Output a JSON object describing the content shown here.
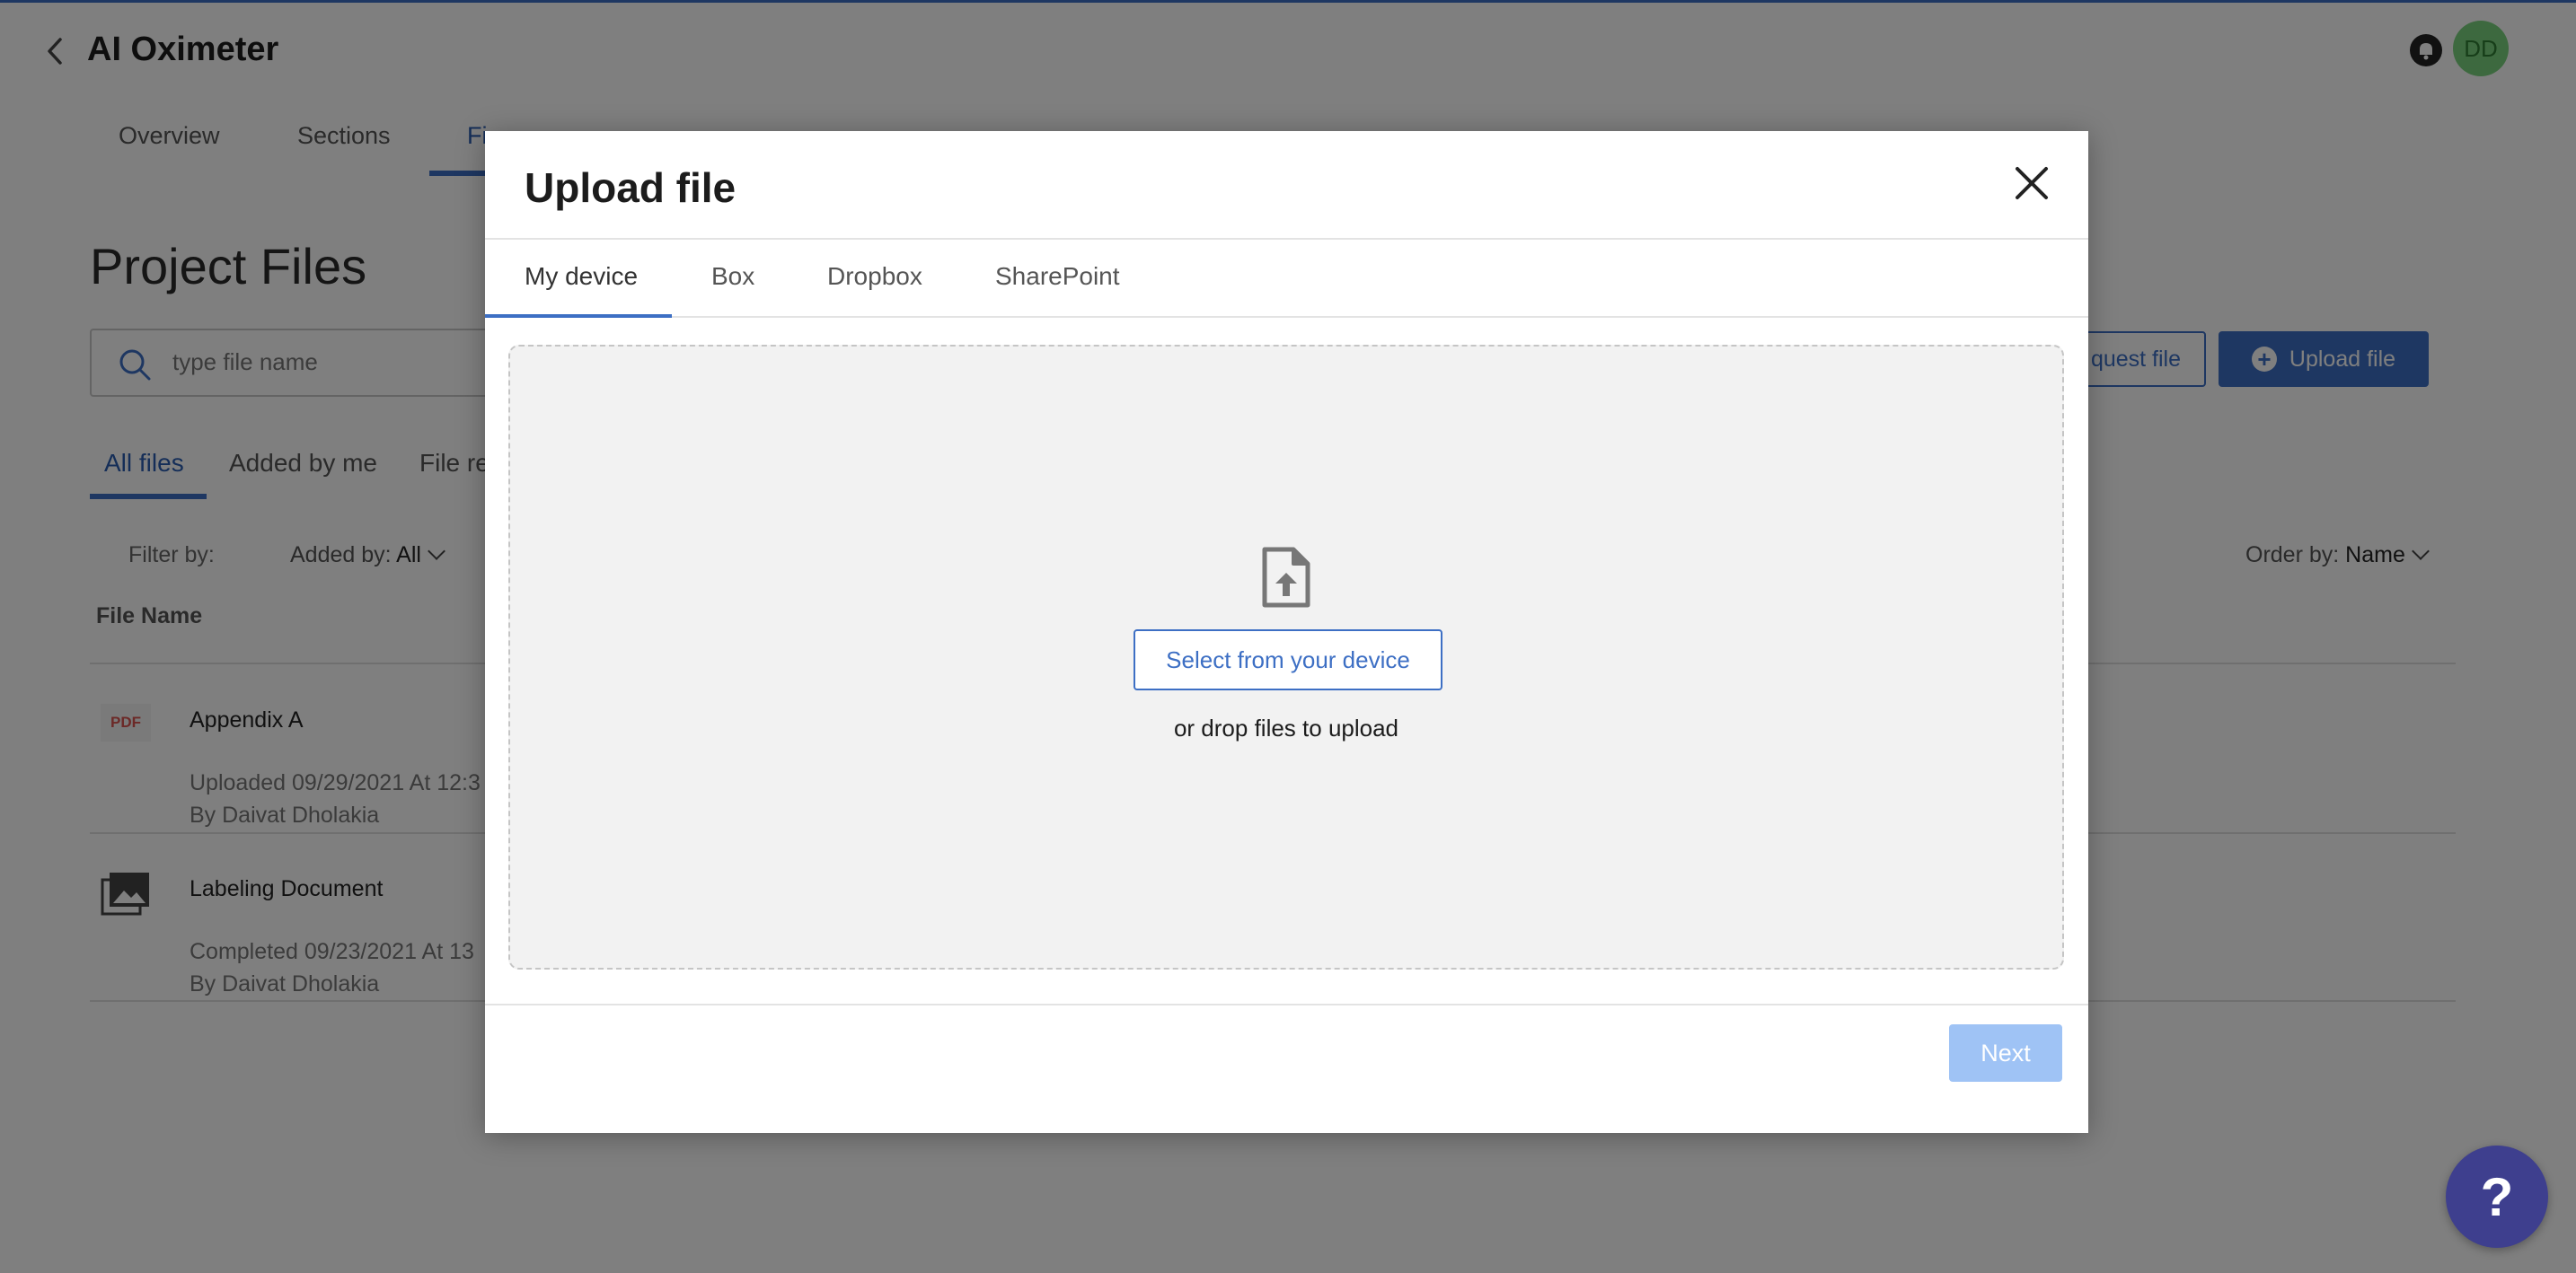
{
  "header": {
    "app_title": "AI Oximeter",
    "avatar_initials": "DD"
  },
  "main_tabs": [
    {
      "label": "Overview"
    },
    {
      "label": "Sections"
    },
    {
      "label": "Fi"
    }
  ],
  "page_title": "Project Files",
  "search": {
    "placeholder": "type file name"
  },
  "actions": {
    "request_label": "quest file",
    "upload_label": "Upload file"
  },
  "sub_tabs": [
    {
      "label": "All files"
    },
    {
      "label": "Added by me"
    },
    {
      "label": "File re"
    }
  ],
  "filters": {
    "filter_label": "Filter by:",
    "added_by_label": "Added by:",
    "added_by_value": "All",
    "order_by_label": "Order by:",
    "order_by_value": "Name"
  },
  "table": {
    "column_file_name": "File Name",
    "rows": [
      {
        "icon_label": "PDF",
        "name": "Appendix A",
        "status": "Uploaded 09/29/2021 At 12:3",
        "by": "By Daivat Dholakia"
      },
      {
        "name": "Labeling Document",
        "status": "Completed 09/23/2021 At 13",
        "by": "By Daivat Dholakia"
      }
    ]
  },
  "modal": {
    "title": "Upload file",
    "tabs": [
      {
        "label": "My device"
      },
      {
        "label": "Box"
      },
      {
        "label": "Dropbox"
      },
      {
        "label": "SharePoint"
      }
    ],
    "select_button": "Select from your device",
    "drop_text": "or drop files to upload",
    "next_button": "Next"
  },
  "help": {
    "label": "?"
  },
  "colors": {
    "accent": "#3d6fc4",
    "next_disabled": "#9fc3f5",
    "help_button": "#3e3f8e",
    "avatar": "#7bd27e"
  }
}
